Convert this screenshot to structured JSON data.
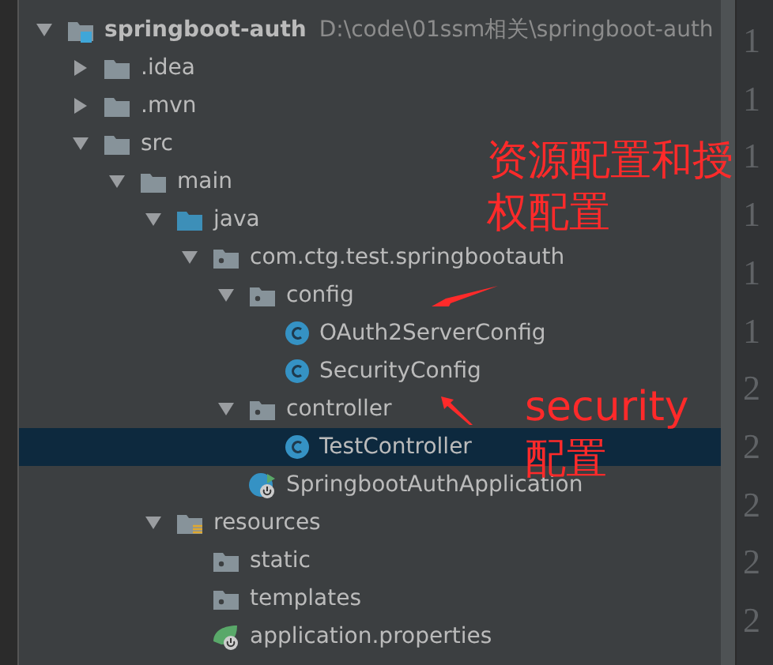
{
  "tree": [
    {
      "label": "springboot-auth",
      "kind": "module",
      "path": "D:\\code\\01ssm相关\\springboot-auth",
      "expanded": true,
      "selected": false,
      "children": [
        {
          "label": ".idea",
          "kind": "folder",
          "expanded": false,
          "selected": false
        },
        {
          "label": ".mvn",
          "kind": "folder",
          "expanded": false,
          "selected": false
        },
        {
          "label": "src",
          "kind": "folder",
          "expanded": true,
          "selected": false,
          "children": [
            {
              "label": "main",
              "kind": "folder",
              "expanded": true,
              "selected": false,
              "children": [
                {
                  "label": "java",
                  "kind": "source",
                  "expanded": true,
                  "selected": false,
                  "children": [
                    {
                      "label": "com.ctg.test.springbootauth",
                      "kind": "package",
                      "expanded": true,
                      "selected": false,
                      "children": [
                        {
                          "label": "config",
                          "kind": "package",
                          "expanded": true,
                          "selected": false,
                          "children": [
                            {
                              "label": "OAuth2ServerConfig",
                              "kind": "class",
                              "selected": false
                            },
                            {
                              "label": "SecurityConfig",
                              "kind": "class",
                              "selected": false
                            }
                          ]
                        },
                        {
                          "label": "controller",
                          "kind": "package",
                          "expanded": true,
                          "selected": false,
                          "children": [
                            {
                              "label": "TestController",
                              "kind": "class",
                              "selected": true
                            }
                          ]
                        },
                        {
                          "label": "SpringbootAuthApplication",
                          "kind": "app",
                          "selected": false
                        }
                      ]
                    }
                  ]
                },
                {
                  "label": "resources",
                  "kind": "resources",
                  "expanded": true,
                  "selected": false,
                  "children": [
                    {
                      "label": "static",
                      "kind": "package",
                      "selected": false
                    },
                    {
                      "label": "templates",
                      "kind": "package",
                      "selected": false
                    },
                    {
                      "label": "application.properties",
                      "kind": "config",
                      "selected": false
                    }
                  ]
                }
              ]
            }
          ]
        }
      ]
    }
  ],
  "line_numbers": [
    "1",
    "1",
    "1",
    "1",
    "1",
    "1",
    "2",
    "2",
    "2",
    "2",
    "2"
  ],
  "annotations": [
    {
      "text": "资源配置和授权配置"
    },
    {
      "text": "security配置"
    }
  ]
}
